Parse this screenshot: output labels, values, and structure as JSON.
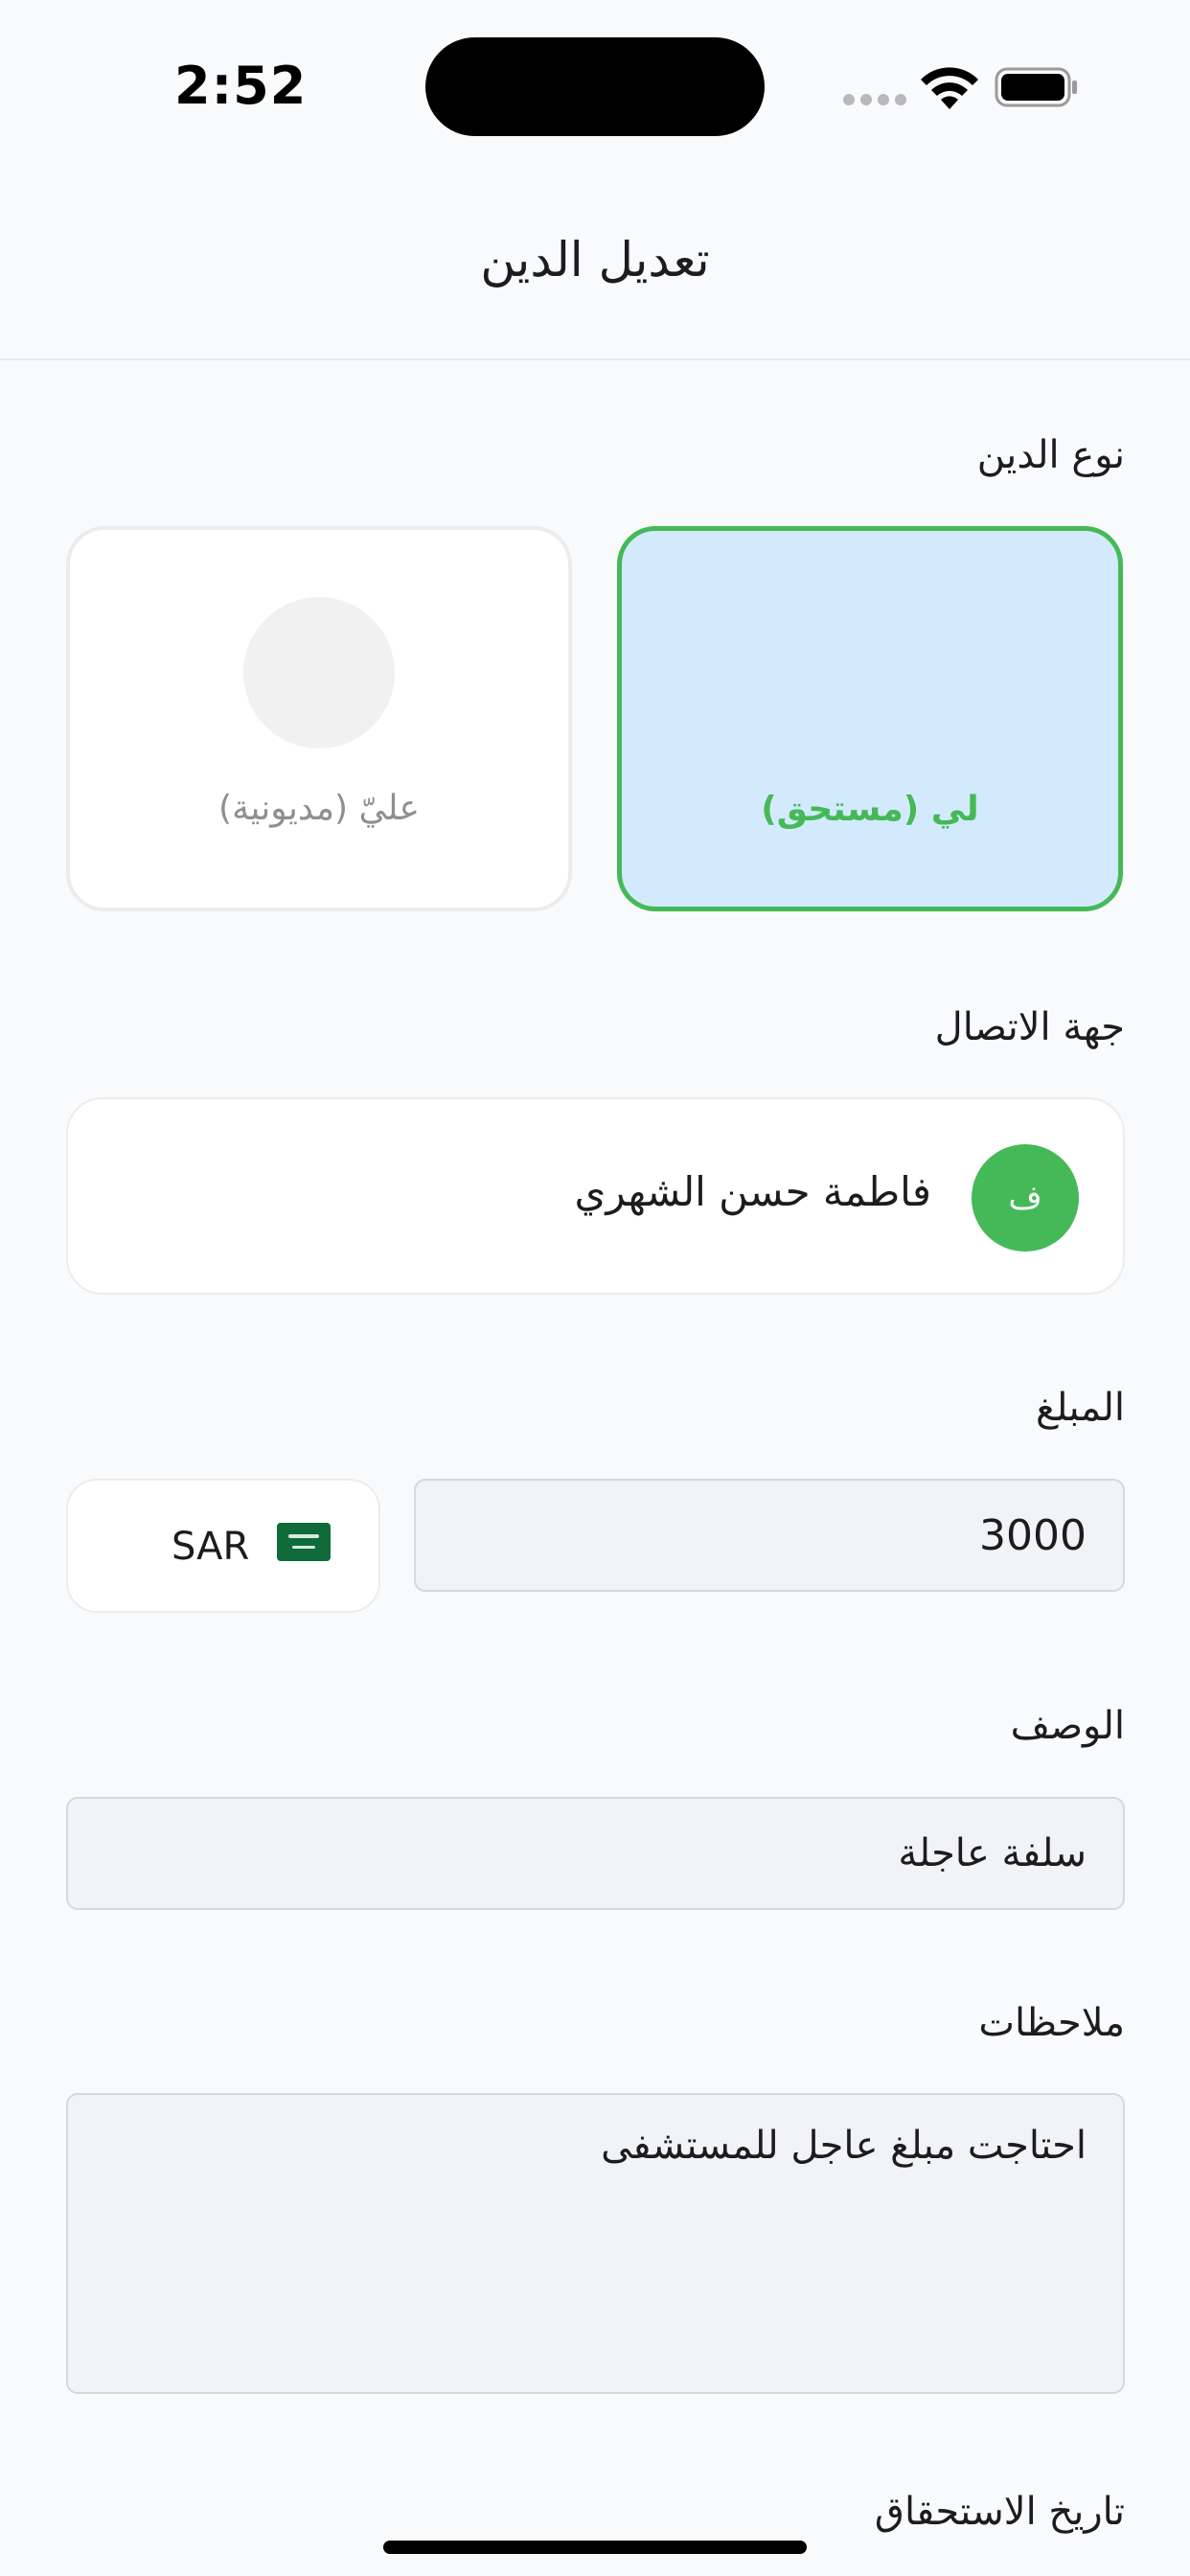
{
  "status_bar": {
    "time": "2:52"
  },
  "header": {
    "title": "تعديل الدين"
  },
  "debt_type": {
    "label": "نوع الدين",
    "options": [
      {
        "label": "لي (مستحق)",
        "selected": true
      },
      {
        "label": "عليّ (مديونية)",
        "selected": false
      }
    ]
  },
  "contact": {
    "label": "جهة الاتصال",
    "name": "فاطمة حسن الشهري",
    "avatar_initial": "ف"
  },
  "amount": {
    "label": "المبلغ",
    "value": "3000",
    "currency": "SAR"
  },
  "description": {
    "label": "الوصف",
    "value": "سلفة عاجلة"
  },
  "notes": {
    "label": "ملاحظات",
    "value": "احتاجت مبلغ عاجل للمستشفى"
  },
  "due_date": {
    "label": "تاريخ الاستحقاق"
  },
  "colors": {
    "accent": "#45b957",
    "selected_bg": "#d3eafd"
  }
}
